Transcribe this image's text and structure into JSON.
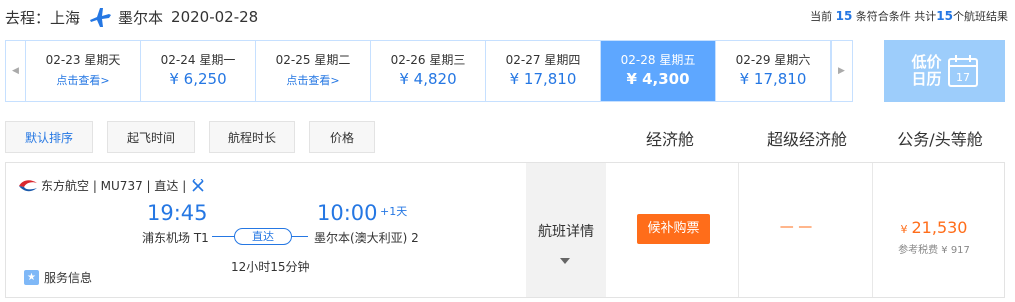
{
  "header": {
    "label": "去程：",
    "origin": "上海",
    "destination": "墨尔本",
    "date": "2020-02-28",
    "summary_prefix": "当前",
    "current_count": "15",
    "summary_mid": "条符合条件 共计",
    "total_count": "15",
    "summary_suffix": "个航班结果"
  },
  "date_strip": [
    {
      "date": "02-23 星期天",
      "price": "点击查看>",
      "is_link": true
    },
    {
      "date": "02-24 星期一",
      "price": "¥ 6,250"
    },
    {
      "date": "02-25 星期二",
      "price": "点击查看>",
      "is_link": true
    },
    {
      "date": "02-26 星期三",
      "price": "¥ 4,820"
    },
    {
      "date": "02-27 星期四",
      "price": "¥ 17,810"
    },
    {
      "date": "02-28 星期五",
      "price": "¥ 4,300",
      "active": true
    },
    {
      "date": "02-29 星期六",
      "price": "¥ 17,810"
    }
  ],
  "low_calendar": {
    "label_line1": "低价",
    "label_line2": "日历",
    "day": "17"
  },
  "sort_options": [
    "默认排序",
    "起飞时间",
    "航程时长",
    "价格"
  ],
  "cabin_headers": [
    "经济舱",
    "超级经济舱",
    "公务/头等舱"
  ],
  "flight": {
    "airline_info": "东方航空 | MU737 | 直达 |",
    "dep_time": "19:45",
    "arr_time": "10:00",
    "day_offset": "+1天",
    "dep_airport": "浦东机场 T1",
    "arr_airport": "墨尔本(澳大利亚) 2",
    "stop_label": "直达",
    "duration": "12小时15分钟",
    "service": "服务信息",
    "detail_label": "航班详情",
    "economy_button": "候补购票",
    "super_economy": "— —",
    "business_currency": "¥",
    "business_price": "21,530",
    "business_tax": "参考税费 ¥ 917"
  },
  "colors": {
    "accent": "#2577e3",
    "orange": "#ff6d1a",
    "active_day": "#5ea7ff",
    "low_cal_bg": "#9dcdfb"
  }
}
